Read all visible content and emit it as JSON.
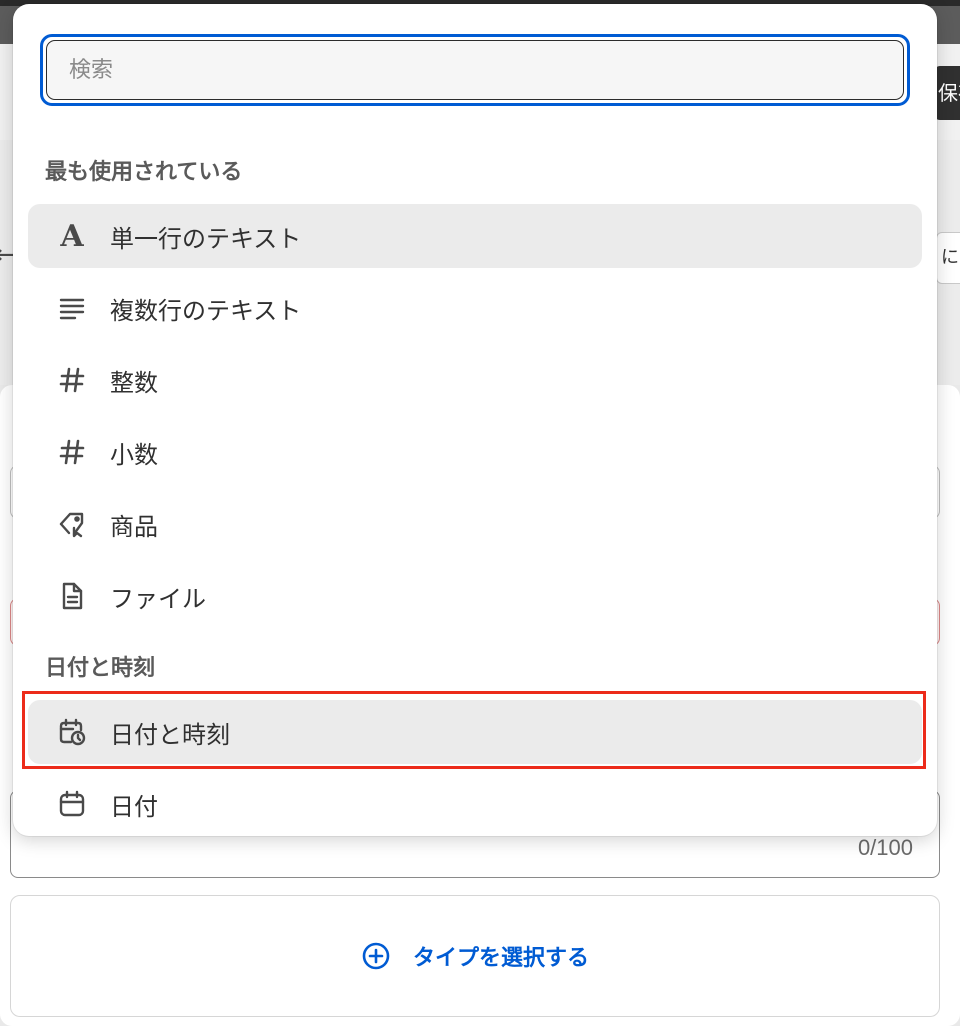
{
  "background": {
    "save_button_label": "保存",
    "right_input_value": "に",
    "back_arrow": "←",
    "counter": "0/100",
    "type_select_label": "タイプを選択する"
  },
  "popover": {
    "search": {
      "placeholder": "検索",
      "value": ""
    },
    "sections": [
      {
        "title": "最も使用されている",
        "items": [
          {
            "label": "単一行のテキスト",
            "icon": "text-a-icon",
            "selected": true
          },
          {
            "label": "複数行のテキスト",
            "icon": "text-lines-icon",
            "selected": false
          },
          {
            "label": "整数",
            "icon": "hash-icon",
            "selected": false
          },
          {
            "label": "小数",
            "icon": "hash-icon",
            "selected": false
          },
          {
            "label": "商品",
            "icon": "product-tag-icon",
            "selected": false
          },
          {
            "label": "ファイル",
            "icon": "file-icon",
            "selected": false
          }
        ]
      },
      {
        "title": "日付と時刻",
        "items": [
          {
            "label": "日付と時刻",
            "icon": "calendar-clock-icon",
            "selected": true,
            "highlighted": true
          },
          {
            "label": "日付",
            "icon": "calendar-icon",
            "selected": false
          }
        ]
      }
    ]
  },
  "colors": {
    "accent_blue": "#005bd3",
    "highlight_red": "#ec2b1a",
    "selected_bg": "#ebebeb"
  }
}
